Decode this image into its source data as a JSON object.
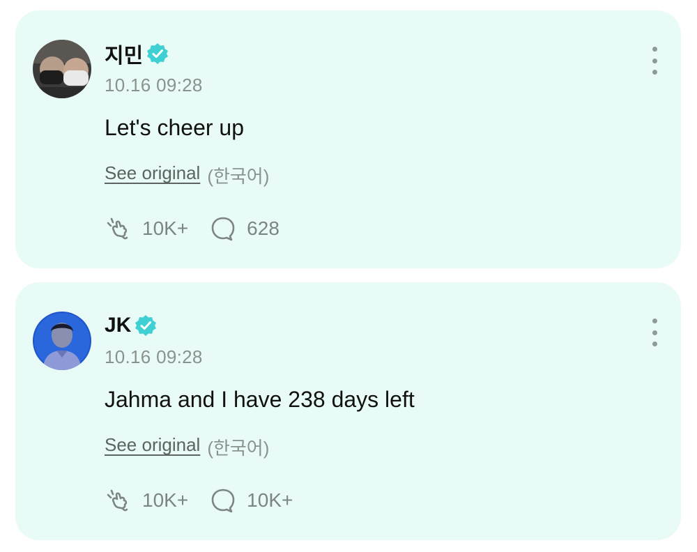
{
  "posts": [
    {
      "author": "지민",
      "time": "10.16 09:28",
      "text": "Let's cheer up",
      "see_original": "See original",
      "language": "(한국어)",
      "cheer_count": "10K+",
      "comment_count": "628"
    },
    {
      "author": "JK",
      "time": "10.16 09:28",
      "text": "Jahma and I have 238 days left",
      "see_original": "See original",
      "language": "(한국어)",
      "cheer_count": "10K+",
      "comment_count": "10K+"
    }
  ],
  "colors": {
    "card_bg": "#e8fbf6",
    "verified": "#3fd0d4",
    "muted_text": "#8a9290"
  },
  "icons": {
    "verified": "verified-badge-icon",
    "more": "more-vertical-icon",
    "cheer": "cheer-hand-icon",
    "comment": "comment-bubble-icon"
  }
}
